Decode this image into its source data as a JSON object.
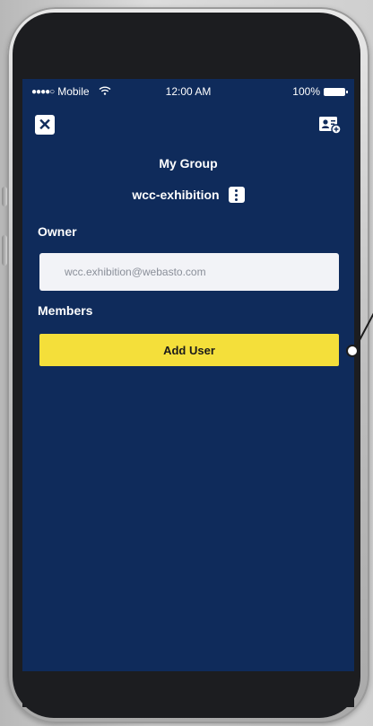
{
  "status_bar": {
    "carrier": "Mobile",
    "signal": "●●●●○",
    "time": "12:00 AM",
    "battery": "100%"
  },
  "header": {
    "close_icon": "close-icon",
    "add_contact_icon": "add-contact-icon"
  },
  "title": "My Group",
  "group": {
    "name": "wcc-exhibition",
    "menu_icon": "more-vertical-icon"
  },
  "owner": {
    "label": "Owner",
    "value": "wcc.exhibition@webasto.com"
  },
  "members": {
    "label": "Members",
    "add_button_label": "Add User"
  },
  "colors": {
    "screen_bg": "#0f2b5b",
    "button_accent": "#f4df3a"
  }
}
